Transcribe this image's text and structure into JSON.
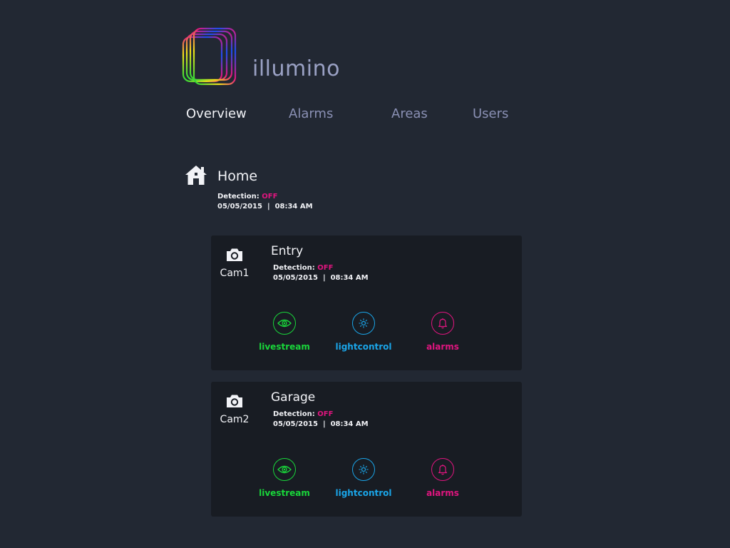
{
  "app": {
    "name": "illumino"
  },
  "nav": [
    {
      "label": "Overview",
      "active": true
    },
    {
      "label": "Alarms",
      "active": false
    },
    {
      "label": "Areas",
      "active": false
    },
    {
      "label": "Users",
      "active": false
    }
  ],
  "home": {
    "title": "Home",
    "detection_label": "Detection:",
    "detection_state": "OFF",
    "date": "05/05/2015",
    "sep": "|",
    "time": "08:34 AM"
  },
  "cameras": [
    {
      "cam_label": "Cam1",
      "title": "Entry",
      "detection_label": "Detection:",
      "detection_state": "OFF",
      "date": "05/05/2015",
      "sep": "|",
      "time": "08:34 AM",
      "actions": [
        "livestream",
        "lightcontrol",
        "alarms"
      ]
    },
    {
      "cam_label": "Cam2",
      "title": "Garage",
      "detection_label": "Detection:",
      "detection_state": "OFF",
      "date": "05/05/2015",
      "sep": "|",
      "time": "08:34 AM",
      "actions": [
        "livestream",
        "lightcontrol",
        "alarms"
      ]
    }
  ],
  "icons": {
    "logo": "illumino-logo",
    "home": "home-icon",
    "camera": "camera-icon",
    "livestream": "eye-icon",
    "lightcontrol": "sun-icon",
    "alarms": "bell-icon"
  },
  "colors": {
    "background": "#222833",
    "card": "#181c23",
    "off": "#e0157f",
    "livestream": "#19d63a",
    "lightcontrol": "#1aa5e8",
    "alarms": "#e0157f"
  }
}
